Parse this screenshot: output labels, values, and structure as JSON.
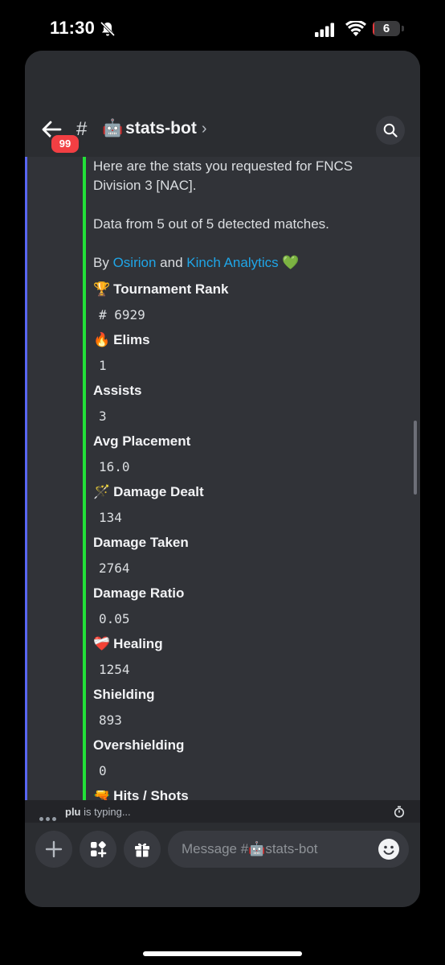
{
  "status_bar": {
    "time": "11:30",
    "battery": "6",
    "battery_level": 0.06
  },
  "header": {
    "unread_badge": "99",
    "hash": "#",
    "channel_emoji": "🤖",
    "channel_name": "stats-bot",
    "chevron": "›",
    "icons": [
      "back-arrow-icon",
      "search-icon"
    ]
  },
  "embed": {
    "intro_line1": "Here are the stats you requested for FNCS",
    "intro_line2": "Division 3 [NAC].",
    "data_line": "Data from 5 out of 5 detected matches.",
    "by_prefix": "By",
    "by_link1": "Osirion",
    "by_and": "and",
    "by_link2": "Kinch Analytics",
    "by_emoji": "💚",
    "accent_color": "#22e038",
    "fields": [
      {
        "emoji": "🏆",
        "name": "Tournament Rank",
        "value": "# 6929"
      },
      {
        "emoji": "🔥",
        "name": "Elims",
        "value": "1"
      },
      {
        "emoji": "",
        "name": "Assists",
        "value": "3"
      },
      {
        "emoji": "",
        "name": "Avg Placement",
        "value": "16.0"
      },
      {
        "emoji": "🪄",
        "name": "Damage Dealt",
        "value": "134"
      },
      {
        "emoji": "",
        "name": "Damage Taken",
        "value": "2764"
      },
      {
        "emoji": "",
        "name": "Damage Ratio",
        "value": "0.05"
      },
      {
        "emoji": "❤️‍🩹",
        "name": "Healing",
        "value": "1254"
      },
      {
        "emoji": "",
        "name": "Shielding",
        "value": "893"
      },
      {
        "emoji": "",
        "name": "Overshielding",
        "value": "0"
      },
      {
        "emoji": "🔫",
        "name": "Hits / Shots",
        "value": ""
      }
    ]
  },
  "typing": {
    "user": "plu",
    "text": "is typing..."
  },
  "composer": {
    "placeholder": "Message #🤖stats-bot",
    "icons": [
      "plus-icon",
      "apps-icon",
      "gift-icon",
      "emoji-icon"
    ]
  }
}
